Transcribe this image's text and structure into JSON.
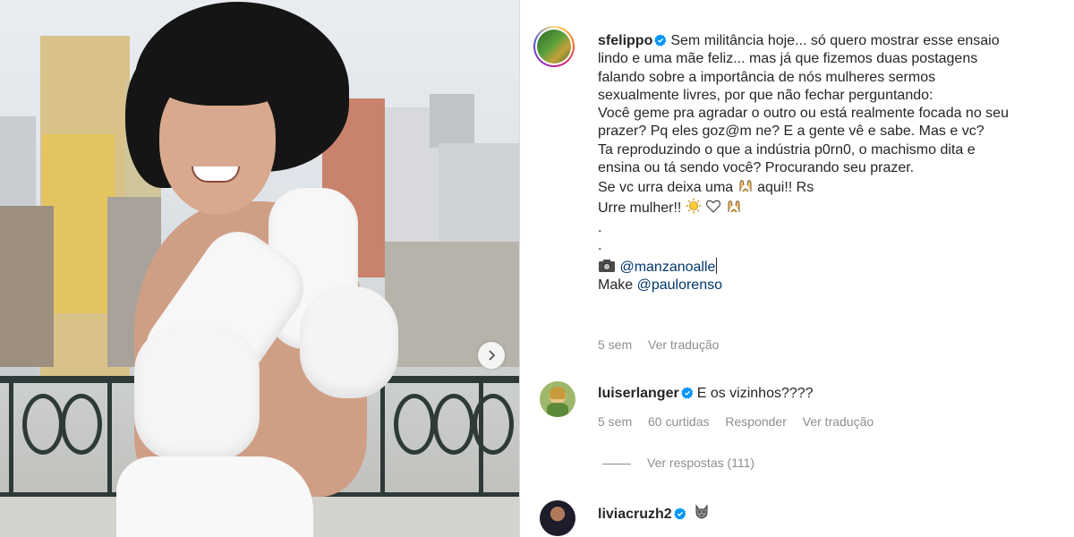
{
  "post": {
    "username": "sfelippo",
    "caption_lines": [
      "Sem militância hoje... só quero mostrar esse ensaio",
      "lindo e uma mãe feliz... mas já que fizemos duas postagens",
      "falando sobre a importância de nós mulheres sermos",
      "sexualmente livres, por que não fechar perguntando:",
      "Você geme pra agradar o outro ou está realmente focada no seu",
      "prazer? Pq eles goz@m ne? E a gente vê e sabe. Mas e vc?",
      "Ta reproduzindo o que a indústria p0rn0, o machismo dita e",
      "ensina ou tá sendo você? Procurando seu prazer."
    ],
    "line_urra_prefix": "Se vc urra deixa uma",
    "line_urra_suffix": "aqui!! Rs",
    "line_urre": "Urre mulher!!",
    "dot1": ".",
    "dot2": ".",
    "photo_credit": "@manzanoalle",
    "make_prefix": "Make",
    "make_handle": "@paulorenso",
    "time": "5 sem",
    "translate": "Ver tradução"
  },
  "comments": [
    {
      "username": "luiserlanger",
      "text": "E os vizinhos????",
      "time": "5 sem",
      "likes": "60 curtidas",
      "reply": "Responder",
      "translate": "Ver tradução",
      "view_replies": "Ver respostas (111)"
    },
    {
      "username": "liviacruzh2",
      "text": ""
    }
  ],
  "icons": {
    "verified": "verified-badge-icon",
    "next": "chevron-right-icon",
    "camera": "camera-icon",
    "wolf": "wolf-emoji-icon",
    "sun": "sun-emoji-icon",
    "heart": "white-heart-emoji-icon",
    "raised_hands": "raising-hands-emoji-icon"
  },
  "colors": {
    "verified": "#0095f6",
    "mention": "#00376b",
    "secondary_text": "#8e8e8e"
  }
}
